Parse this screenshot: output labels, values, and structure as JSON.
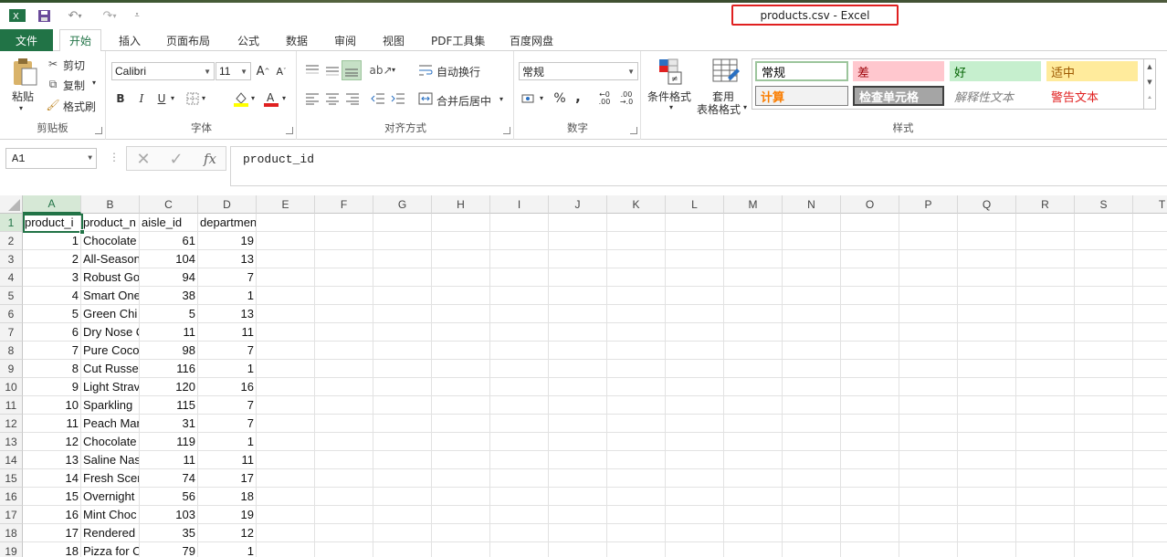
{
  "window": {
    "title": "products.csv - Excel"
  },
  "tabs": {
    "file": "文件",
    "items": [
      "开始",
      "插入",
      "页面布局",
      "公式",
      "数据",
      "审阅",
      "视图",
      "PDF工具集",
      "百度网盘"
    ]
  },
  "ribbon": {
    "clipboard": {
      "paste": "粘贴",
      "cut": "剪切",
      "copy": "复制",
      "format_painter": "格式刷",
      "label": "剪贴板"
    },
    "font": {
      "name": "Calibri",
      "size": "11",
      "bold": "B",
      "italic": "I",
      "underline": "U",
      "label": "字体"
    },
    "alignment": {
      "wrap": "自动换行",
      "merge": "合并后居中",
      "label": "对齐方式"
    },
    "number": {
      "format": "常规",
      "percent": "%",
      "comma": ",",
      "label": "数字"
    },
    "styles": {
      "conditional": "条件格式",
      "table_format_1": "套用",
      "table_format_2": "表格格式",
      "cells": [
        "常规",
        "差",
        "好",
        "适中",
        "计算",
        "检查单元格",
        "解释性文本",
        "警告文本"
      ],
      "label": "样式"
    }
  },
  "formula_bar": {
    "name_box": "A1",
    "fx": "fx",
    "content": "product_id"
  },
  "grid": {
    "columns": [
      "A",
      "B",
      "C",
      "D",
      "E",
      "F",
      "G",
      "H",
      "I",
      "J",
      "K",
      "L",
      "M",
      "N",
      "O",
      "P",
      "Q",
      "R",
      "S",
      "T"
    ],
    "rows": [
      [
        "product_i",
        "product_n",
        "aisle_id",
        "department_id"
      ],
      [
        "1",
        "Chocolate",
        "61",
        "19"
      ],
      [
        "2",
        "All-Season",
        "104",
        "13"
      ],
      [
        "3",
        "Robust Go",
        "94",
        "7"
      ],
      [
        "4",
        "Smart One",
        "38",
        "1"
      ],
      [
        "5",
        "Green Chi",
        "5",
        "13"
      ],
      [
        "6",
        "Dry Nose C",
        "11",
        "11"
      ],
      [
        "7",
        "Pure Coco",
        "98",
        "7"
      ],
      [
        "8",
        "Cut Russet",
        "116",
        "1"
      ],
      [
        "9",
        "Light Strav",
        "120",
        "16"
      ],
      [
        "10",
        "Sparkling",
        "115",
        "7"
      ],
      [
        "11",
        "Peach Man",
        "31",
        "7"
      ],
      [
        "12",
        "Chocolate",
        "119",
        "1"
      ],
      [
        "13",
        "Saline Nas",
        "11",
        "11"
      ],
      [
        "14",
        "Fresh Scer",
        "74",
        "17"
      ],
      [
        "15",
        "Overnight",
        "56",
        "18"
      ],
      [
        "16",
        "Mint Choc",
        "103",
        "19"
      ],
      [
        "17",
        "Rendered",
        "35",
        "12"
      ],
      [
        "18",
        "Pizza for C",
        "79",
        "1"
      ]
    ]
  },
  "colors": {
    "accent": "#217346",
    "highlight": "#e02020"
  }
}
